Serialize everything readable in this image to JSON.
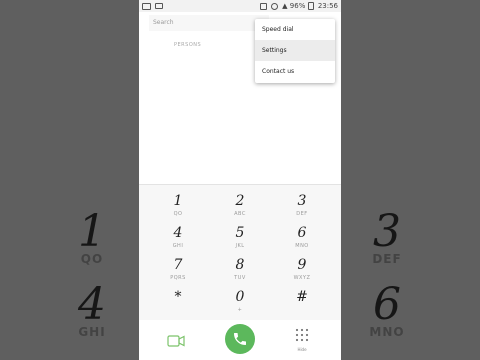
{
  "status_bar": {
    "battery": "96%",
    "time": "23:56"
  },
  "search": {
    "placeholder": "Search"
  },
  "tab": {
    "label": "PERSONS"
  },
  "overflow_menu": {
    "items": [
      {
        "label": "Speed dial",
        "selected": false
      },
      {
        "label": "Settings",
        "selected": true
      },
      {
        "label": "Contact us",
        "selected": false
      }
    ]
  },
  "keypad": {
    "keys": [
      {
        "digit": "1",
        "letters": "QO"
      },
      {
        "digit": "2",
        "letters": "ABC"
      },
      {
        "digit": "3",
        "letters": "DEF"
      },
      {
        "digit": "4",
        "letters": "GHI"
      },
      {
        "digit": "5",
        "letters": "JKL"
      },
      {
        "digit": "6",
        "letters": "MNO"
      },
      {
        "digit": "7",
        "letters": "PQRS"
      },
      {
        "digit": "8",
        "letters": "TUV"
      },
      {
        "digit": "9",
        "letters": "WXYZ"
      },
      {
        "digit": "*",
        "letters": ""
      },
      {
        "digit": "0",
        "letters": "+"
      },
      {
        "digit": "#",
        "letters": ""
      }
    ]
  },
  "bottom_bar": {
    "hide_label": "Hide",
    "call_color": "#5cb85c",
    "video_call_color": "#7cc36b"
  },
  "backdrop": {
    "left": [
      {
        "digit": "1",
        "letters": "QO"
      },
      {
        "digit": "4",
        "letters": "GHI"
      }
    ],
    "right": [
      {
        "digit": "3",
        "letters": "DEF"
      },
      {
        "digit": "6",
        "letters": "MNO"
      }
    ]
  }
}
